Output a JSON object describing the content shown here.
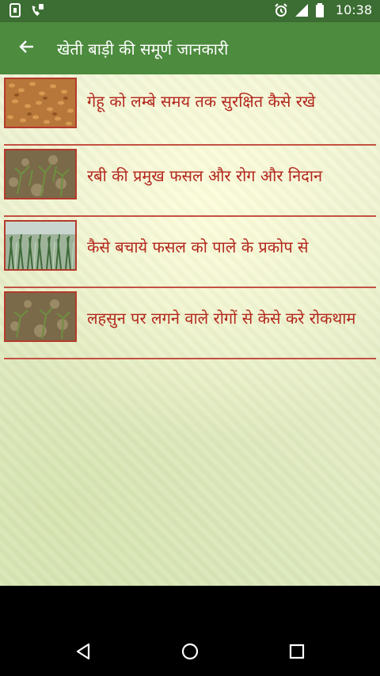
{
  "status_bar": {
    "time": "10:38",
    "left_icons": [
      "sd-card-icon",
      "phone-wifi-icon"
    ],
    "right_icons": [
      "alarm-icon",
      "cell-signal-icon",
      "battery-icon"
    ]
  },
  "app_bar": {
    "title": "खेती बाड़ी की समूर्ण जानकारी",
    "back_icon": "arrow-left-icon"
  },
  "list": {
    "items": [
      {
        "label": "गेहू को लम्बे समय तक सुरक्षित कैसे रखे",
        "thumbnail": "wheat-grains"
      },
      {
        "label": "रबी की प्रमुख फसल और रोग और निदान",
        "thumbnail": "crop-field-soil"
      },
      {
        "label": "कैसे बचाये फसल को पाले के प्रकोप से",
        "thumbnail": "green-crop-field"
      },
      {
        "label": "लहसुन पर लगने वाले रोगों से केसे करे रोकथाम",
        "thumbnail": "crop-field-soil"
      }
    ]
  },
  "nav_bar": {
    "buttons": [
      "back-triangle-icon",
      "home-circle-icon",
      "recents-square-icon"
    ]
  },
  "colors": {
    "status_bar": "#3c6e33",
    "app_bar": "#4d8b3e",
    "label_text": "#b3271d",
    "separator": "#c45143"
  }
}
